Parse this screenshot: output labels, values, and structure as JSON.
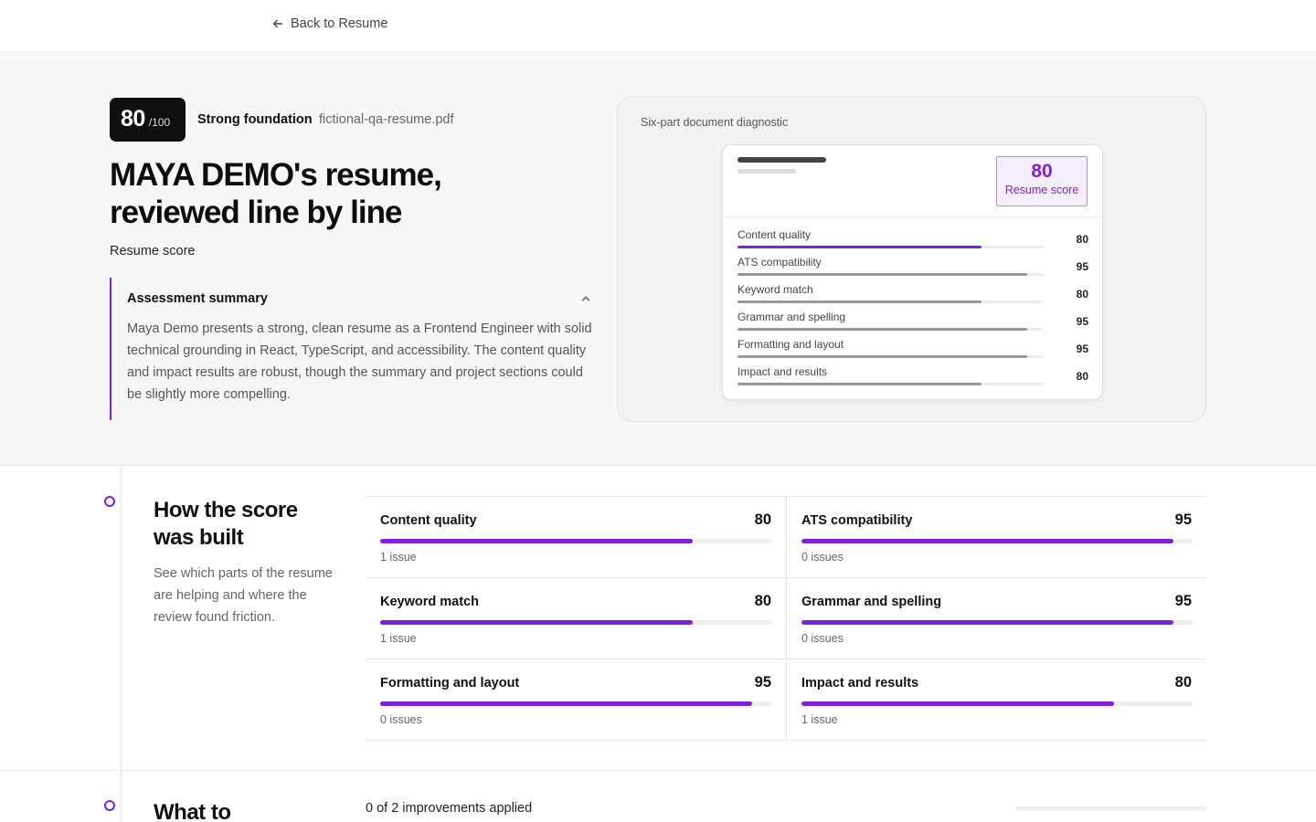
{
  "nav": {
    "back_label": "Back to Resume"
  },
  "hero": {
    "score": "80",
    "score_max": "/100",
    "verdict": "Strong foundation",
    "filename": "fictional-qa-resume.pdf",
    "title": "MAYA DEMO's resume, reviewed line by line",
    "subtitle": "Resume score",
    "summary": {
      "heading": "Assessment summary",
      "body": "Maya Demo presents a strong, clean resume as a Frontend Engineer with solid technical grounding in React, TypeScript, and accessibility. The content quality and impact results are robust, though the summary and project sections could be slightly more compelling."
    }
  },
  "diagnostic": {
    "title": "Six-part document diagnostic",
    "score": "80",
    "score_label": "Resume score",
    "rows": [
      {
        "label": "Content quality",
        "value": 80,
        "accent": true
      },
      {
        "label": "ATS compatibility",
        "value": 95,
        "accent": false
      },
      {
        "label": "Keyword match",
        "value": 80,
        "accent": false
      },
      {
        "label": "Grammar and spelling",
        "value": 95,
        "accent": false
      },
      {
        "label": "Formatting and layout",
        "value": 95,
        "accent": false
      },
      {
        "label": "Impact and results",
        "value": 80,
        "accent": false
      }
    ]
  },
  "breakdown": {
    "title": "How the score was built",
    "description": "See which parts of the resume are helping and where the review found friction.",
    "categories": [
      {
        "name": "Content quality",
        "score": 80,
        "issues": "1 issue"
      },
      {
        "name": "ATS compatibility",
        "score": 95,
        "issues": "0 issues"
      },
      {
        "name": "Keyword match",
        "score": 80,
        "issues": "1 issue"
      },
      {
        "name": "Grammar and spelling",
        "score": 95,
        "issues": "0 issues"
      },
      {
        "name": "Formatting and layout",
        "score": 95,
        "issues": "0 issues"
      },
      {
        "name": "Impact and results",
        "score": 80,
        "issues": "1 issue"
      }
    ]
  },
  "improve": {
    "title": "What to",
    "applied_text": "0 of 2 improvements applied",
    "applied_fraction": 0
  },
  "colors": {
    "accent": "#7b22d9",
    "muted_bar": "#999999"
  },
  "icons": {
    "back": "arrow-left-icon",
    "collapse": "chevron-up-icon"
  }
}
